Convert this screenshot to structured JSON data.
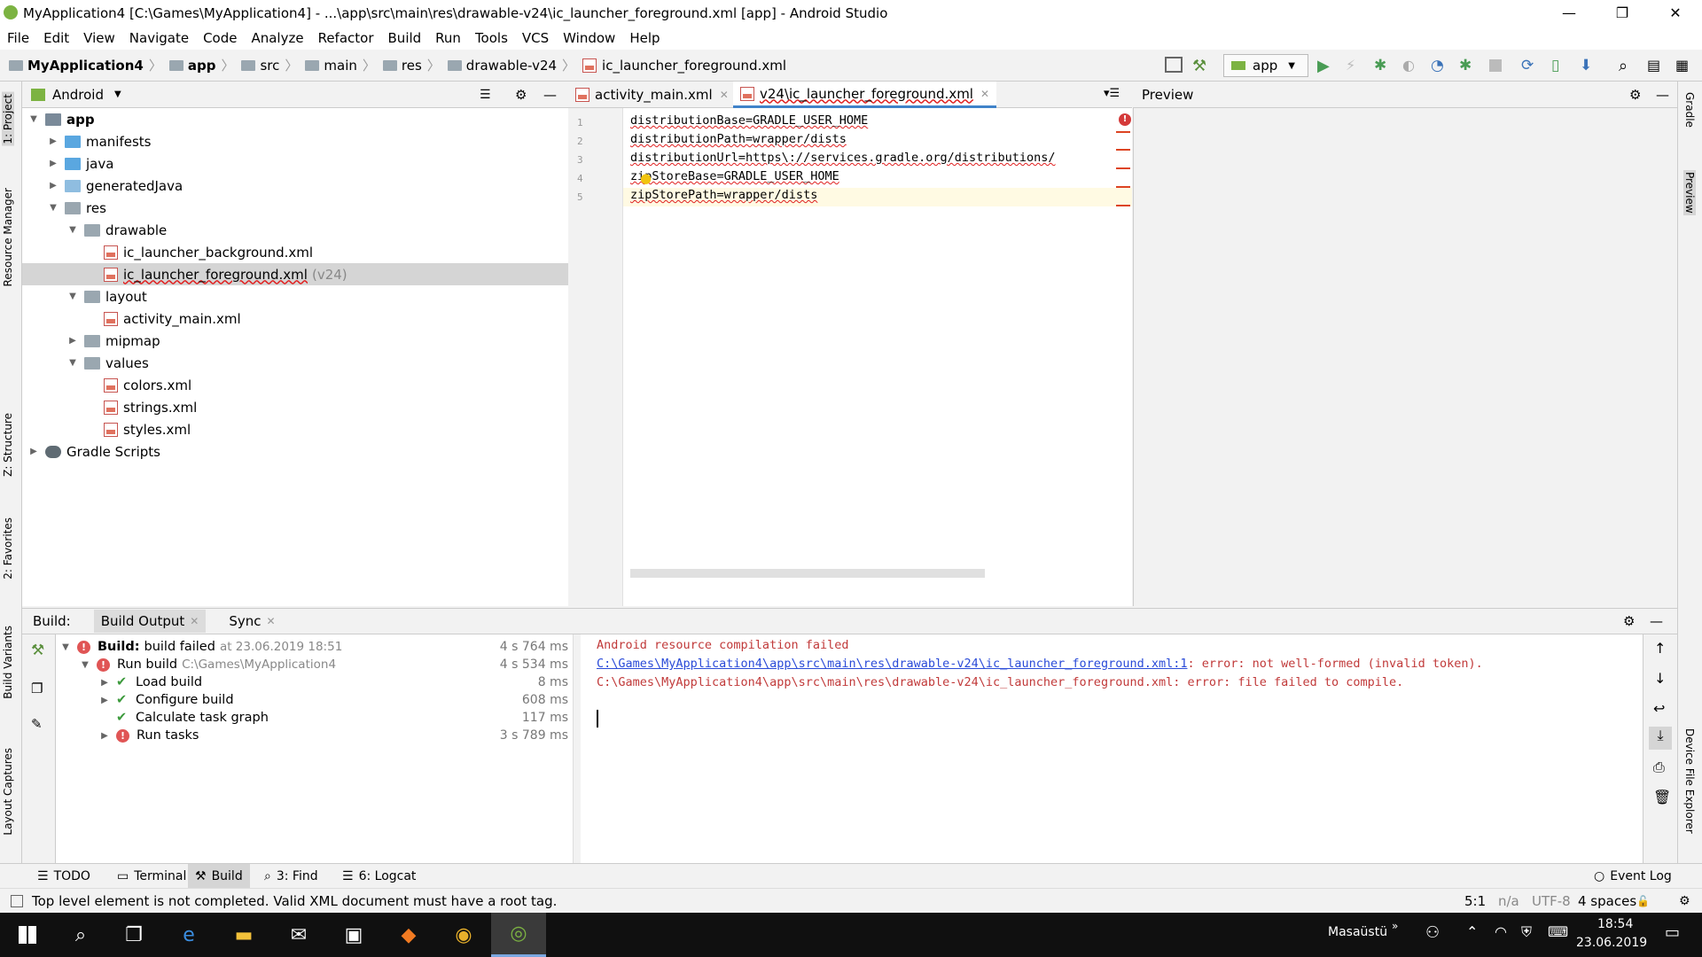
{
  "window": {
    "title": "MyApplication4 [C:\\Games\\MyApplication4] - ...\\app\\src\\main\\res\\drawable-v24\\ic_launcher_foreground.xml [app] - Android Studio",
    "minimize": "—",
    "maximize": "❐",
    "close": "✕"
  },
  "menu": [
    "File",
    "Edit",
    "View",
    "Navigate",
    "Code",
    "Analyze",
    "Refactor",
    "Build",
    "Run",
    "Tools",
    "VCS",
    "Window",
    "Help"
  ],
  "breadcrumb": [
    "MyApplication4",
    "app",
    "src",
    "main",
    "res",
    "drawable-v24",
    "ic_launcher_foreground.xml"
  ],
  "toolbar": {
    "run_config": "app"
  },
  "left_stripe": [
    "1: Project",
    "Resource Manager",
    "Z: Structure",
    "2: Favorites",
    "Build Variants",
    "Layout Captures"
  ],
  "right_stripe": [
    "Gradle",
    "Preview",
    "Device File Explorer"
  ],
  "project": {
    "view_label": "Android",
    "tree": [
      {
        "label": "app",
        "depth": 0,
        "arrow": "▼",
        "icon": "module",
        "bold": true
      },
      {
        "label": "manifests",
        "depth": 1,
        "arrow": "▶",
        "icon": "folder-blue"
      },
      {
        "label": "java",
        "depth": 1,
        "arrow": "▶",
        "icon": "folder-blue"
      },
      {
        "label": "generatedJava",
        "depth": 1,
        "arrow": "▶",
        "icon": "folder-gen"
      },
      {
        "label": "res",
        "depth": 1,
        "arrow": "▼",
        "icon": "folder"
      },
      {
        "label": "drawable",
        "depth": 2,
        "arrow": "▼",
        "icon": "folder"
      },
      {
        "label": "ic_launcher_background.xml",
        "depth": 3,
        "arrow": "",
        "icon": "xml"
      },
      {
        "label": "ic_launcher_foreground.xml",
        "depth": 3,
        "arrow": "",
        "icon": "xml",
        "suffix": "(v24)",
        "selected": true
      },
      {
        "label": "layout",
        "depth": 2,
        "arrow": "▼",
        "icon": "folder"
      },
      {
        "label": "activity_main.xml",
        "depth": 3,
        "arrow": "",
        "icon": "xml"
      },
      {
        "label": "mipmap",
        "depth": 2,
        "arrow": "▶",
        "icon": "folder"
      },
      {
        "label": "values",
        "depth": 2,
        "arrow": "▼",
        "icon": "folder"
      },
      {
        "label": "colors.xml",
        "depth": 3,
        "arrow": "",
        "icon": "xml"
      },
      {
        "label": "strings.xml",
        "depth": 3,
        "arrow": "",
        "icon": "xml"
      },
      {
        "label": "styles.xml",
        "depth": 3,
        "arrow": "",
        "icon": "xml"
      },
      {
        "label": "Gradle Scripts",
        "depth": 0,
        "arrow": "▶",
        "icon": "gradle"
      }
    ]
  },
  "editor": {
    "tabs": [
      {
        "label": "activity_main.xml",
        "active": false
      },
      {
        "label": "v24\\ic_launcher_foreground.xml",
        "active": true
      }
    ],
    "lines": [
      "distributionBase=GRADLE_USER_HOME",
      "    distributionPath=wrapper/dists",
      "    distributionUrl=https\\://services.gradle.org/distributions/",
      "    zipStoreBase=GRADLE_USER_HOME",
      "    zipStorePath=wrapper/dists"
    ]
  },
  "preview": {
    "title": "Preview"
  },
  "build": {
    "tabs": [
      "Build:",
      "Build Output",
      "Sync"
    ],
    "tree": [
      {
        "label": "Build:",
        "detail": "build failed",
        "muted": "at 23.06.2019 18:51",
        "time": "4 s 764 ms",
        "status": "error",
        "depth": 0,
        "arrow": "▼"
      },
      {
        "label": "Run build",
        "muted": "C:\\Games\\MyApplication4",
        "time": "4 s 534 ms",
        "status": "error",
        "depth": 1,
        "arrow": "▼"
      },
      {
        "label": "Load build",
        "time": "8 ms",
        "status": "ok",
        "depth": 2,
        "arrow": "▶"
      },
      {
        "label": "Configure build",
        "time": "608 ms",
        "status": "ok",
        "depth": 2,
        "arrow": "▶"
      },
      {
        "label": "Calculate task graph",
        "time": "117 ms",
        "status": "ok",
        "depth": 2,
        "arrow": ""
      },
      {
        "label": "Run tasks",
        "time": "3 s 789 ms",
        "status": "error",
        "depth": 2,
        "arrow": "▶"
      }
    ],
    "output": {
      "line1": "Android resource compilation failed",
      "line2_link": "C:\\Games\\MyApplication4\\app\\src\\main\\res\\drawable-v24\\ic_launcher_foreground.xml:1",
      "line2_rest": ": error: not well-formed (invalid token).",
      "line3": "C:\\Games\\MyApplication4\\app\\src\\main\\res\\drawable-v24\\ic_launcher_foreground.xml: error: file failed to compile."
    }
  },
  "bottom_tools": [
    "TODO",
    "Terminal",
    "Build",
    "3: Find",
    "6: Logcat"
  ],
  "event_log": "Event Log",
  "status": {
    "message": "Top level element is not completed. Valid XML document must have a root tag.",
    "position": "5:1",
    "line_sep": "n/a",
    "encoding": "UTF-8",
    "indent": "4 spaces"
  },
  "taskbar": {
    "desktop_label": "Masaüstü",
    "time": "18:54",
    "date": "23.06.2019"
  }
}
